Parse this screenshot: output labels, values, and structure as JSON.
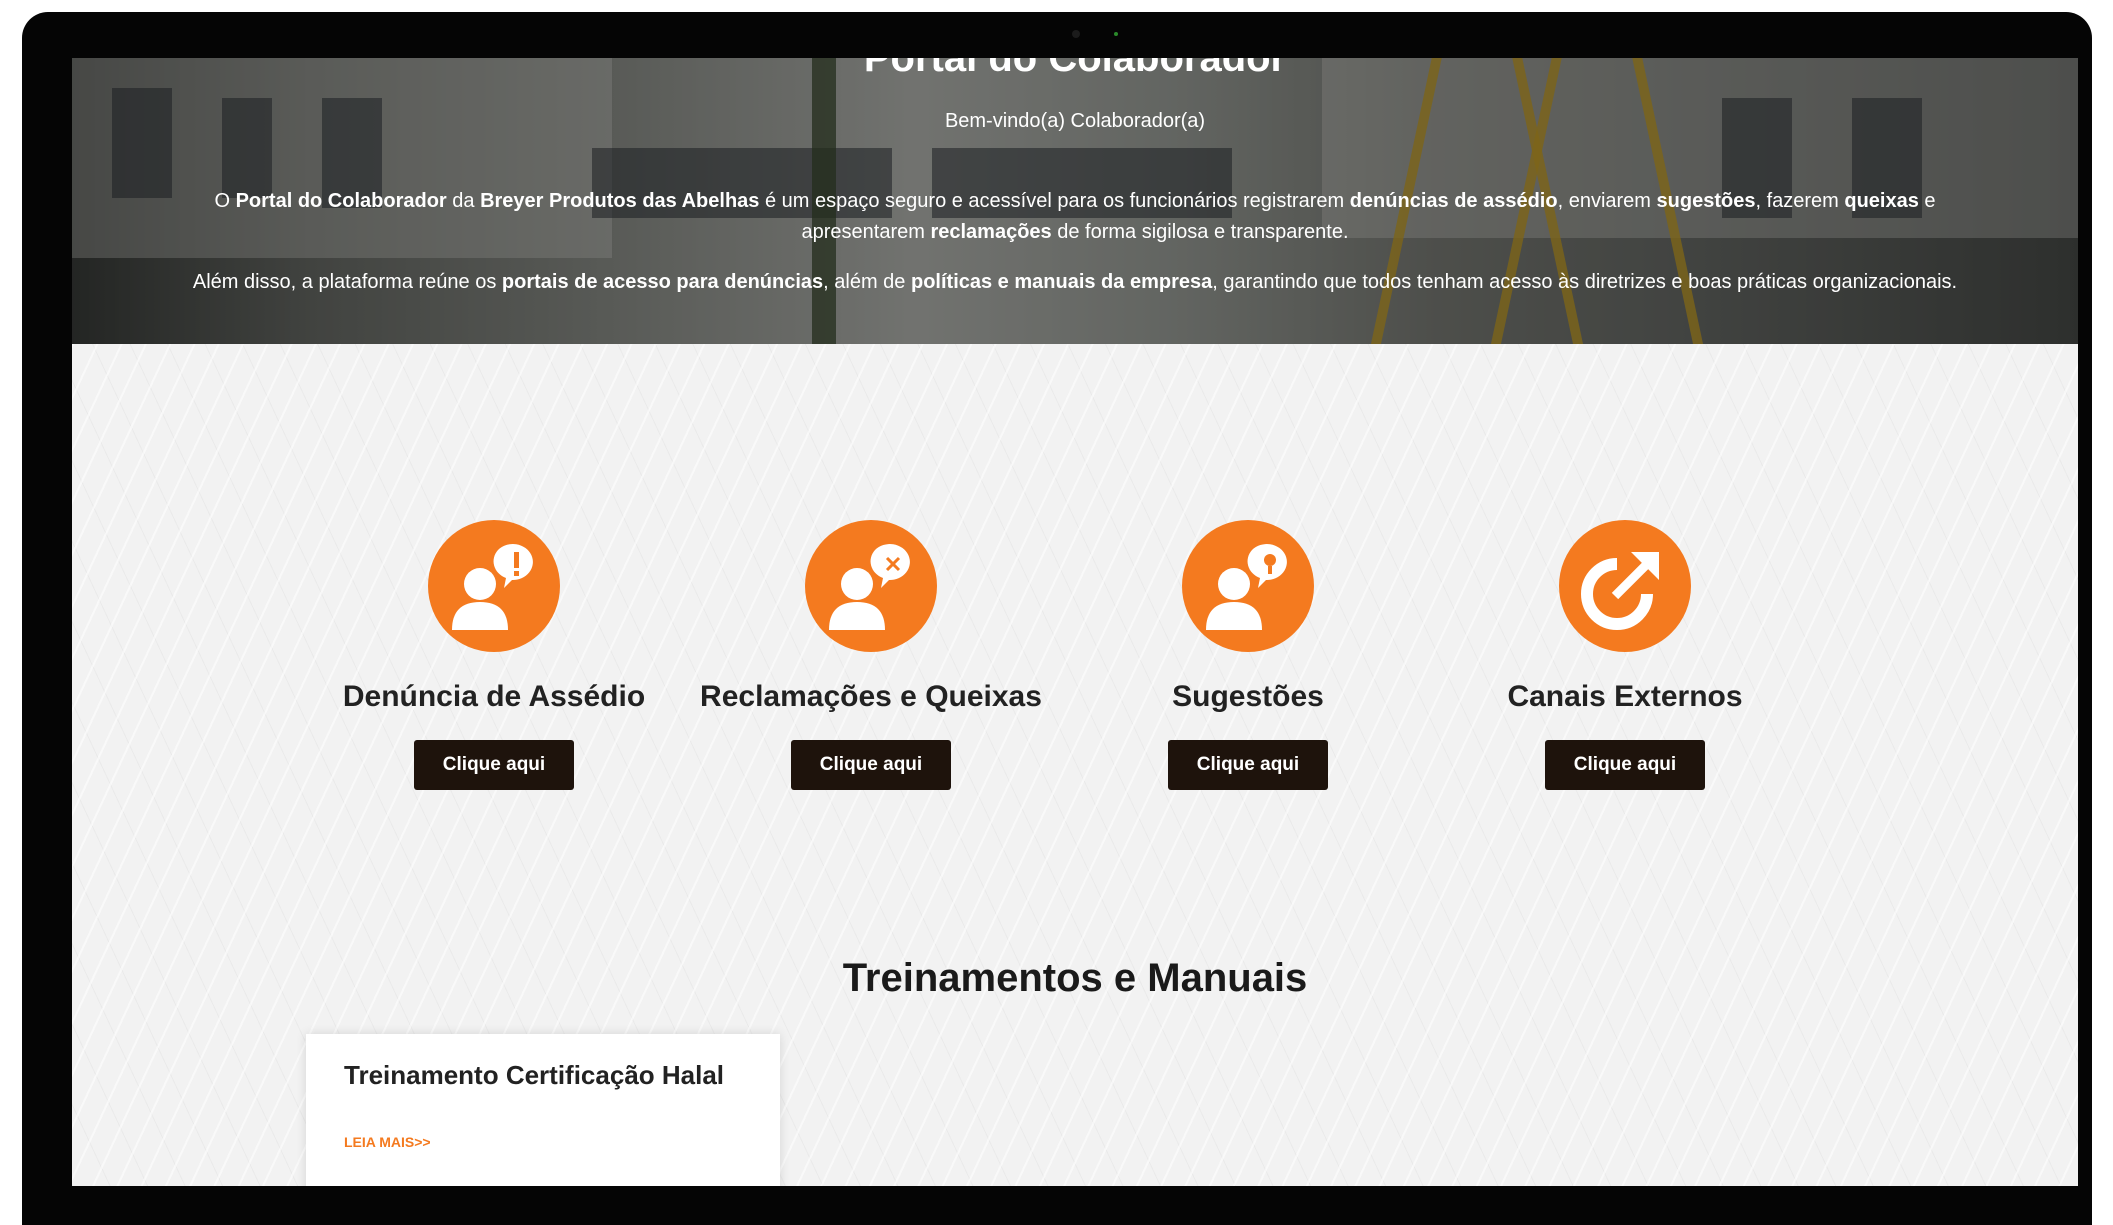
{
  "hero": {
    "title": "Portal do Colaborador",
    "subtitle": "Bem-vindo(a) Colaborador(a)",
    "p1_a": "O ",
    "p1_b": "Portal do Colaborador",
    "p1_c": " da ",
    "p1_d": "Breyer Produtos das Abelhas",
    "p1_e": " é um espaço seguro e acessível para os funcionários registrarem ",
    "p1_f": "denúncias de assédio",
    "p1_g": ", enviarem ",
    "p1_h": "sugestões",
    "p1_i": ", fazerem ",
    "p1_j": "queixas",
    "p1_k": " e apresentarem ",
    "p1_l": "reclamações",
    "p1_m": " de forma sigilosa e transparente.",
    "p2_a": "Além disso, a plataforma reúne os ",
    "p2_b": "portais de acesso para denúncias",
    "p2_c": ", além de ",
    "p2_d": "políticas e manuais da empresa",
    "p2_e": ", garantindo que todos tenham acesso às diretrizes e boas práticas organizacionais."
  },
  "cards": [
    {
      "title": "Denúncia de Assédio",
      "button": "Clique aqui",
      "icon": "person-alert-icon"
    },
    {
      "title": "Reclamações e Queixas",
      "button": "Clique aqui",
      "icon": "person-complaint-icon"
    },
    {
      "title": "Sugestões",
      "button": "Clique aqui",
      "icon": "person-idea-icon"
    },
    {
      "title": "Canais Externos",
      "button": "Clique aqui",
      "icon": "external-arrow-icon"
    }
  ],
  "section": {
    "title": "Treinamentos e Manuais"
  },
  "post": {
    "title": "Treinamento Certificação Halal",
    "link": "LEIA MAIS>>"
  },
  "colors": {
    "accent": "#f47a1f",
    "button": "#1e130c"
  }
}
